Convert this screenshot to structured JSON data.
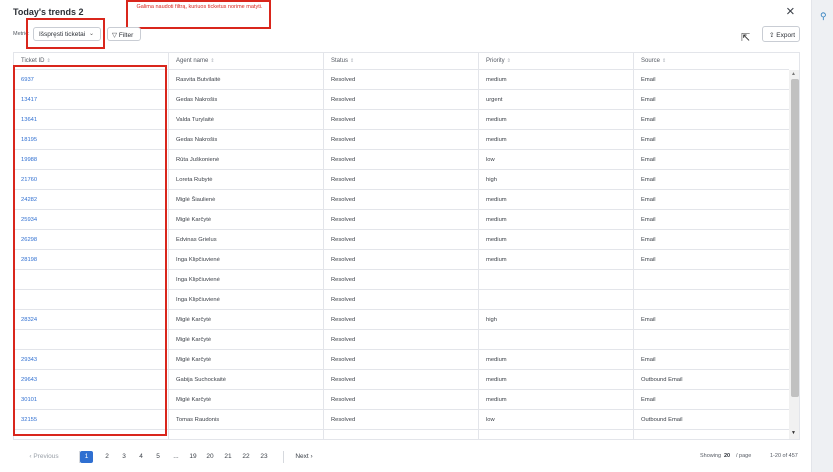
{
  "modal": {
    "title": "Today's trends 2",
    "close_icon": "×"
  },
  "annotation": {
    "text": "Galima naudoti filtrą, kuriuos ticketus norime matyti."
  },
  "toolbar": {
    "metric_label": "Metric:",
    "metric_value": "Išspręsti ticketai",
    "filter_label": "Filter",
    "export_label": "Export"
  },
  "table": {
    "columns": [
      "Ticket ID",
      "Agent name",
      "Status",
      "Priority",
      "Source"
    ],
    "rows": [
      [
        "6937",
        "Rasvita Butvilaitė",
        "Resolved",
        "medium",
        "Email"
      ],
      [
        "13417",
        "Gedas Nakrošis",
        "Resolved",
        "urgent",
        "Email"
      ],
      [
        "13641",
        "Valda Turylaitė",
        "Resolved",
        "medium",
        "Email"
      ],
      [
        "18195",
        "Gedas Nakrošis",
        "Resolved",
        "medium",
        "Email"
      ],
      [
        "19988",
        "Rūta Juškonienė",
        "Resolved",
        "low",
        "Email"
      ],
      [
        "21760",
        "Loreta Rubytė",
        "Resolved",
        "high",
        "Email"
      ],
      [
        "24282",
        "Miglė Šiaulienė",
        "Resolved",
        "medium",
        "Email"
      ],
      [
        "25934",
        "Miglė Karčytė",
        "Resolved",
        "medium",
        "Email"
      ],
      [
        "26298",
        "Edvinas Grielus",
        "Resolved",
        "medium",
        "Email"
      ],
      [
        "28198",
        "Inga Klipčiuvienė",
        "Resolved",
        "medium",
        "Email"
      ],
      [
        "",
        "Inga Klipčiuvienė",
        "Resolved",
        "",
        ""
      ],
      [
        "",
        "Inga Klipčiuvienė",
        "Resolved",
        "",
        ""
      ],
      [
        "28324",
        "Miglė Karčytė",
        "Resolved",
        "high",
        "Email"
      ],
      [
        "",
        "Miglė Karčytė",
        "Resolved",
        "",
        ""
      ],
      [
        "29343",
        "Miglė Karčytė",
        "Resolved",
        "medium",
        "Email"
      ],
      [
        "29643",
        "Gabija Suchockaitė",
        "Resolved",
        "medium",
        "Outbound Email"
      ],
      [
        "30101",
        "Miglė Karčytė",
        "Resolved",
        "medium",
        "Email"
      ],
      [
        "32155",
        "Tomas Raudonis",
        "Resolved",
        "low",
        "Outbound Email"
      ],
      [
        "",
        "",
        "",
        "",
        ""
      ]
    ]
  },
  "pagination": {
    "previous": "‹  Previous",
    "pages": [
      "1",
      "2",
      "3",
      "4",
      "5",
      "...",
      "19",
      "20",
      "21",
      "22",
      "23"
    ],
    "current_page": "1",
    "next": "Next  ›",
    "showing_label": "Showing",
    "per_page": "20",
    "per_page_suffix": "/  page",
    "range": "1-20 of 457"
  },
  "colors": {
    "accent": "#2f6fd1",
    "annotation_red": "#d9261c"
  },
  "icons": {
    "close": "close-icon",
    "filter": "filter-icon",
    "export": "export-icon",
    "chevron": "chevron-down-icon",
    "sort": "sort-icon"
  }
}
